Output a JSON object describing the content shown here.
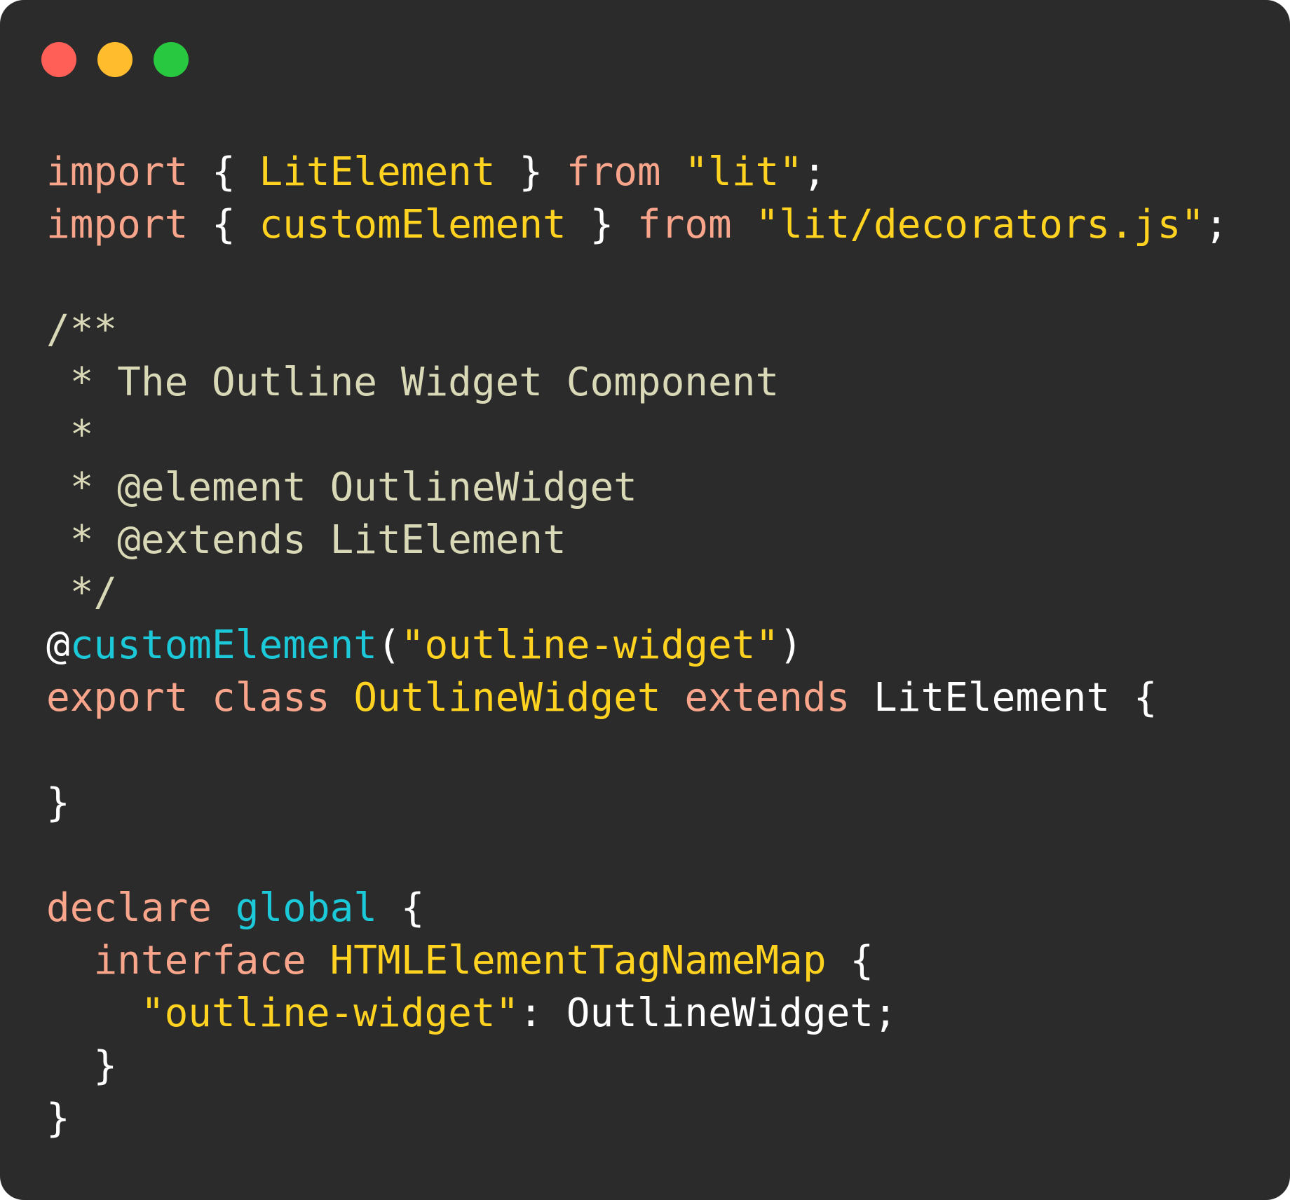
{
  "window": {
    "background": "#2b2b2b",
    "controls": [
      {
        "name": "close-button",
        "color": "#ff5f57"
      },
      {
        "name": "minimize-button",
        "color": "#ffbd2e"
      },
      {
        "name": "maximize-button",
        "color": "#28c840"
      }
    ]
  },
  "palette": {
    "keyword": "#f9a58b",
    "string": "#ffd320",
    "identifier": "#ffd320",
    "comment": "#d9d9b8",
    "function": "#1cc9d9",
    "plain": "#ffffff"
  },
  "code": {
    "language": "typescript",
    "lines": [
      [
        {
          "t": "import",
          "k": "keyword"
        },
        {
          "t": " { ",
          "k": "plain"
        },
        {
          "t": "LitElement",
          "k": "identifier"
        },
        {
          "t": " } ",
          "k": "plain"
        },
        {
          "t": "from",
          "k": "keyword"
        },
        {
          "t": " ",
          "k": "plain"
        },
        {
          "t": "\"lit\"",
          "k": "string"
        },
        {
          "t": ";",
          "k": "plain"
        }
      ],
      [
        {
          "t": "import",
          "k": "keyword"
        },
        {
          "t": " { ",
          "k": "plain"
        },
        {
          "t": "customElement",
          "k": "identifier"
        },
        {
          "t": " } ",
          "k": "plain"
        },
        {
          "t": "from",
          "k": "keyword"
        },
        {
          "t": " ",
          "k": "plain"
        },
        {
          "t": "\"lit/decorators.js\"",
          "k": "string"
        },
        {
          "t": ";",
          "k": "plain"
        }
      ],
      [],
      [
        {
          "t": "/**",
          "k": "comment"
        }
      ],
      [
        {
          "t": " * The Outline Widget Component",
          "k": "comment"
        }
      ],
      [
        {
          "t": " *",
          "k": "comment"
        }
      ],
      [
        {
          "t": " * @element OutlineWidget",
          "k": "comment"
        }
      ],
      [
        {
          "t": " * @extends LitElement",
          "k": "comment"
        }
      ],
      [
        {
          "t": " */",
          "k": "comment"
        }
      ],
      [
        {
          "t": "@",
          "k": "plain"
        },
        {
          "t": "customElement",
          "k": "function"
        },
        {
          "t": "(",
          "k": "plain"
        },
        {
          "t": "\"outline-widget\"",
          "k": "string"
        },
        {
          "t": ")",
          "k": "plain"
        }
      ],
      [
        {
          "t": "export",
          "k": "keyword"
        },
        {
          "t": " ",
          "k": "plain"
        },
        {
          "t": "class",
          "k": "keyword"
        },
        {
          "t": " ",
          "k": "plain"
        },
        {
          "t": "OutlineWidget",
          "k": "identifier"
        },
        {
          "t": " ",
          "k": "plain"
        },
        {
          "t": "extends",
          "k": "keyword"
        },
        {
          "t": " LitElement {",
          "k": "plain"
        }
      ],
      [],
      [
        {
          "t": "}",
          "k": "plain"
        }
      ],
      [],
      [
        {
          "t": "declare",
          "k": "keyword"
        },
        {
          "t": " ",
          "k": "plain"
        },
        {
          "t": "global",
          "k": "function"
        },
        {
          "t": " {",
          "k": "plain"
        }
      ],
      [
        {
          "t": "  ",
          "k": "plain"
        },
        {
          "t": "interface",
          "k": "keyword"
        },
        {
          "t": " ",
          "k": "plain"
        },
        {
          "t": "HTMLElementTagNameMap",
          "k": "identifier"
        },
        {
          "t": " {",
          "k": "plain"
        }
      ],
      [
        {
          "t": "    ",
          "k": "plain"
        },
        {
          "t": "\"outline-widget\"",
          "k": "string"
        },
        {
          "t": ": OutlineWidget;",
          "k": "plain"
        }
      ],
      [
        {
          "t": "  }",
          "k": "plain"
        }
      ],
      [
        {
          "t": "}",
          "k": "plain"
        }
      ]
    ]
  }
}
